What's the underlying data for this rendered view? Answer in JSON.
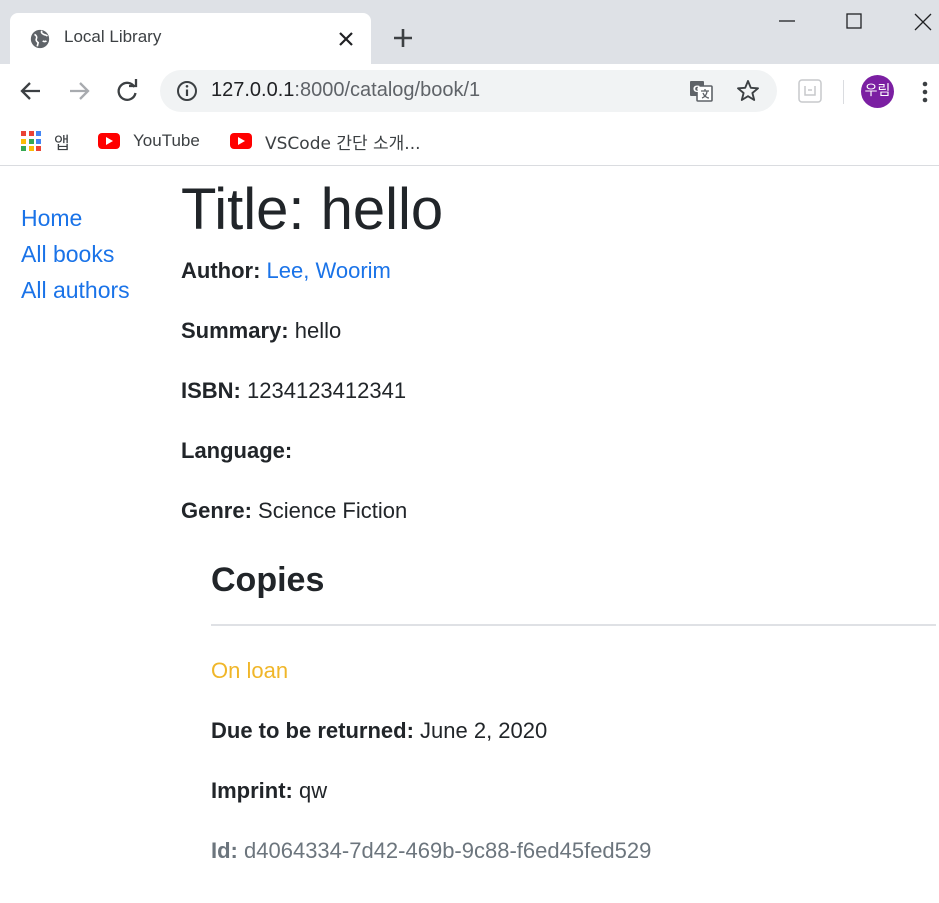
{
  "browser": {
    "tab_title": "Local Library",
    "url_host": "127.0.0.1",
    "url_path": ":8000/catalog/book/1",
    "profile_initials": "우림",
    "accent": "#7b1fa2"
  },
  "bookmarks": [
    {
      "label": "앱",
      "icon": "apps-grid-icon"
    },
    {
      "label": "YouTube",
      "icon": "youtube-icon"
    },
    {
      "label": "VSCode 간단 소개...",
      "icon": "youtube-icon"
    }
  ],
  "sidebar": {
    "items": [
      {
        "label": "Home"
      },
      {
        "label": "All books"
      },
      {
        "label": "All authors"
      }
    ]
  },
  "book": {
    "title": "Title: hello",
    "author_label": "Author:",
    "author_value": "Lee, Woorim",
    "summary_label": "Summary:",
    "summary_value": "hello",
    "isbn_label": "ISBN:",
    "isbn_value": "1234123412341",
    "language_label": "Language:",
    "language_value": "",
    "genre_label": "Genre:",
    "genre_value": "Science Fiction"
  },
  "copies": {
    "heading": "Copies",
    "items": [
      {
        "status": "On loan",
        "status_color": "#f0b629",
        "due_label": "Due to be returned:",
        "due_value": "June 2, 2020",
        "imprint_label": "Imprint:",
        "imprint_value": "qw",
        "id_label": "Id:",
        "id_value": "d4064334-7d42-469b-9c88-f6ed45fed529"
      }
    ]
  },
  "colors": {
    "link": "#1a73e8",
    "text": "#212529",
    "muted": "#6c757d"
  }
}
